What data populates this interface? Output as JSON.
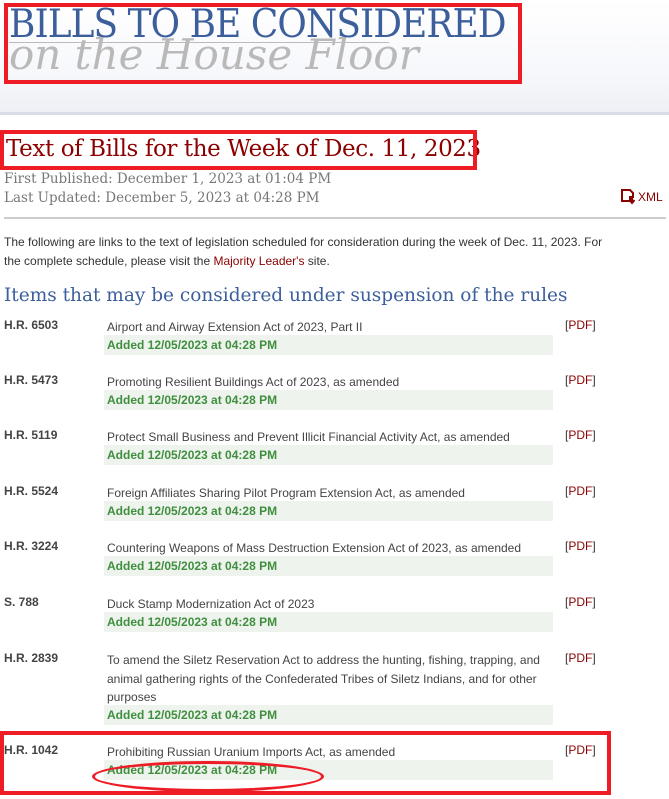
{
  "banner": {
    "line1": "BILLS TO BE CONSIDERED",
    "line2": "on the House Floor"
  },
  "title": "Text of Bills for the Week of Dec. 11, 2023",
  "first_published": "First Published: December 1, 2023 at 01:04 PM",
  "last_updated": "Last Updated: December 5, 2023 at 04:28 PM",
  "xml_label": "XML",
  "intro_text": "The following are links to the text of legislation scheduled for consideration during the week of Dec. 11, 2023. For the complete schedule, please visit the ",
  "intro_link": "Majority Leader's",
  "intro_end": " site.",
  "section_heading": "Items that may be considered under suspension of the rules",
  "pdf_label": "PDF",
  "bills": [
    {
      "number": "H.R. 6503",
      "title": "Airport and Airway Extension Act of 2023, Part II",
      "added": "Added 12/05/2023 at 04:28 PM"
    },
    {
      "number": "H.R. 5473",
      "title": "Promoting Resilient Buildings Act of 2023, as amended",
      "added": "Added 12/05/2023 at 04:28 PM"
    },
    {
      "number": "H.R. 5119",
      "title": "Protect Small Business and Prevent Illicit Financial Activity Act, as amended",
      "added": "Added 12/05/2023 at 04:28 PM"
    },
    {
      "number": "H.R. 5524",
      "title": "Foreign Affiliates Sharing Pilot Program Extension Act, as amended",
      "added": "Added 12/05/2023 at 04:28 PM"
    },
    {
      "number": "H.R. 3224",
      "title": "Countering Weapons of Mass Destruction Extension Act of 2023, as amended",
      "added": "Added 12/05/2023 at 04:28 PM"
    },
    {
      "number": "S. 788",
      "title": "Duck Stamp Modernization Act of 2023",
      "added": "Added 12/05/2023 at 04:28 PM"
    },
    {
      "number": "H.R. 2839",
      "title": "To amend the Siletz Reservation Act to address the hunting, fishing, trapping, and animal gathering rights of the Confederated Tribes of Siletz Indians, and for other purposes",
      "added": "Added 12/05/2023 at 04:28 PM"
    },
    {
      "number": "H.R. 1042",
      "title": "Prohibiting Russian Uranium Imports Act, as amended",
      "added": "Added 12/05/2023 at 04:28 PM"
    }
  ]
}
